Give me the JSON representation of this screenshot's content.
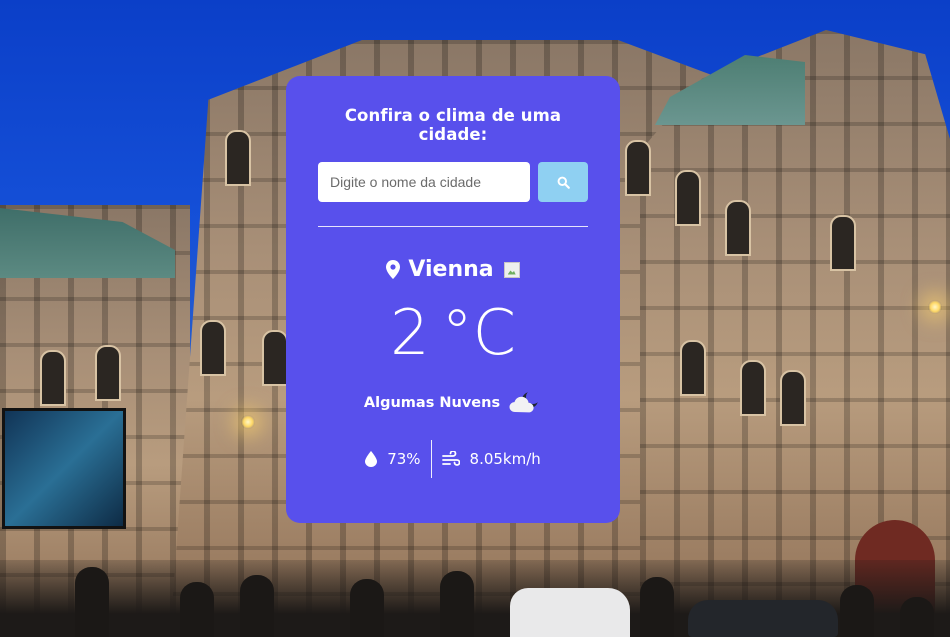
{
  "search": {
    "title": "Confira o clima de uma cidade:",
    "placeholder": "Digite o nome da cidade",
    "value": "",
    "button_icon": "search-icon"
  },
  "weather": {
    "city": "Vienna",
    "city_icon": "map-pin-icon",
    "country_flag_icon": "broken-image-icon",
    "temperature": "2",
    "unit": "°C",
    "description": "Algumas Nuvens",
    "description_icon": "cloud-night-icon",
    "humidity": "73%",
    "humidity_icon": "droplet-icon",
    "wind": "8.05km/h",
    "wind_icon": "wind-icon"
  },
  "colors": {
    "card": "#5850ec",
    "search_button": "#8fd0f2",
    "text": "#ffffff"
  }
}
